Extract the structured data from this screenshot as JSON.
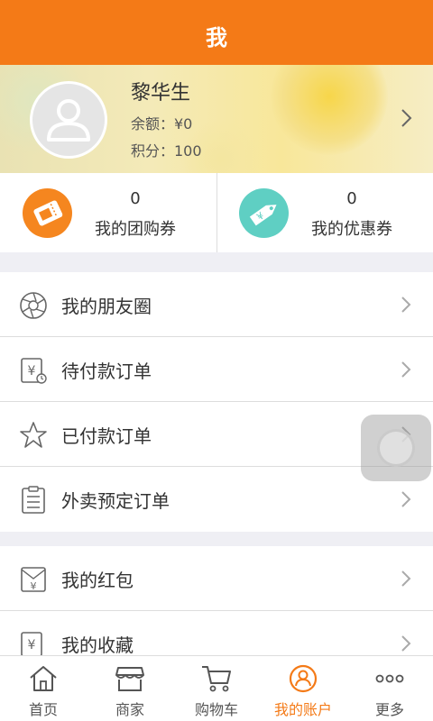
{
  "header": {
    "title": "我"
  },
  "profile": {
    "name": "黎华生",
    "balance": "余额：¥0",
    "points": "积分：100"
  },
  "coupons": [
    {
      "count": "0",
      "label": "我的团购券",
      "icon": "group-buy-ticket-icon",
      "color": "#f5861f"
    },
    {
      "count": "0",
      "label": "我的优惠券",
      "icon": "discount-tag-icon",
      "color": "#5fcfc3"
    }
  ],
  "menu_group_1": [
    {
      "label": "我的朋友圈",
      "icon": "aperture-icon"
    },
    {
      "label": "待付款订单",
      "icon": "pending-payment-icon"
    },
    {
      "label": "已付款订单",
      "icon": "star-icon"
    },
    {
      "label": "外卖预定订单",
      "icon": "order-list-icon"
    }
  ],
  "menu_group_2": [
    {
      "label": "我的红包",
      "icon": "red-envelope-icon"
    },
    {
      "label": "我的收藏",
      "icon": "favorites-icon"
    }
  ],
  "tabbar": [
    {
      "label": "首页",
      "icon": "home-icon",
      "active": false
    },
    {
      "label": "商家",
      "icon": "store-icon",
      "active": false
    },
    {
      "label": "购物车",
      "icon": "cart-icon",
      "active": false
    },
    {
      "label": "我的账户",
      "icon": "account-icon",
      "active": true
    },
    {
      "label": "更多",
      "icon": "more-icon",
      "active": false
    }
  ],
  "colors": {
    "accent": "#f47a17",
    "background": "#efeff4"
  }
}
